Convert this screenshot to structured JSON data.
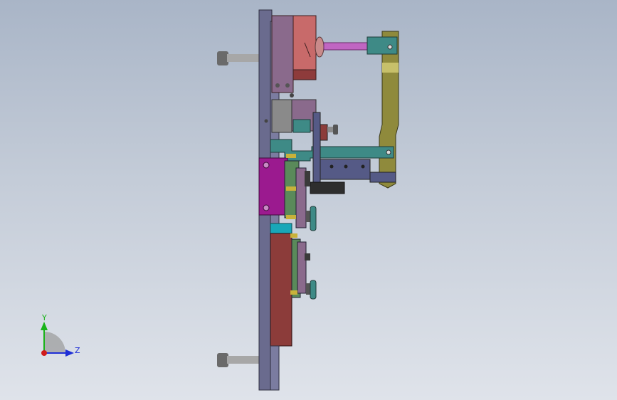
{
  "view": {
    "triad": {
      "y_label": "Y",
      "z_label": "Z",
      "colors": {
        "y": "#19b319",
        "z": "#1f2fd6",
        "x": "#d01a1a"
      }
    },
    "palette": {
      "base_plate": "#6a6b8e",
      "upper_block": "#c86a6a",
      "upper_block_dark": "#8e3b3b",
      "slider_gray": "#8a8a8a",
      "mauve": "#8a6a8c",
      "teal": "#3e8a86",
      "magenta": "#9b1a8f",
      "olive_arm": "#8f8a3c",
      "olive_pad": "#c7c06a",
      "rod": "#c066c2",
      "brown_lower": "#8c3c3a",
      "green_guides": "#5a8a5a",
      "dark_bolt": "#3a3a3a",
      "bolt_gray": "#8b8b8b",
      "cyan": "#19a7b8",
      "indigo": "#555a86",
      "yellow": "#c8b23a"
    }
  }
}
